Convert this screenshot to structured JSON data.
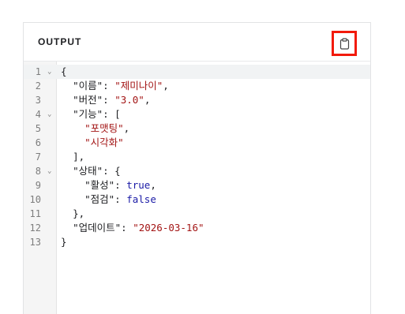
{
  "panel": {
    "title": "OUTPUT",
    "copy_icon": "clipboard-icon"
  },
  "editor": {
    "fold_glyph": "⌄",
    "lines": [
      {
        "n": "1",
        "fold": true,
        "active": true,
        "indent": "",
        "parts": [
          {
            "t": "{",
            "c": "punc"
          }
        ]
      },
      {
        "n": "2",
        "fold": false,
        "active": false,
        "indent": "  ",
        "parts": [
          {
            "t": "\"이름\"",
            "c": "key"
          },
          {
            "t": ": ",
            "c": "punc"
          },
          {
            "t": "\"제미나이\"",
            "c": "str"
          },
          {
            "t": ",",
            "c": "punc"
          }
        ]
      },
      {
        "n": "3",
        "fold": false,
        "active": false,
        "indent": "  ",
        "parts": [
          {
            "t": "\"버전\"",
            "c": "key"
          },
          {
            "t": ": ",
            "c": "punc"
          },
          {
            "t": "\"3.0\"",
            "c": "str"
          },
          {
            "t": ",",
            "c": "punc"
          }
        ]
      },
      {
        "n": "4",
        "fold": true,
        "active": false,
        "indent": "  ",
        "parts": [
          {
            "t": "\"기능\"",
            "c": "key"
          },
          {
            "t": ": [",
            "c": "punc"
          }
        ]
      },
      {
        "n": "5",
        "fold": false,
        "active": false,
        "indent": "    ",
        "parts": [
          {
            "t": "\"포맷팅\"",
            "c": "str"
          },
          {
            "t": ",",
            "c": "punc"
          }
        ]
      },
      {
        "n": "6",
        "fold": false,
        "active": false,
        "indent": "    ",
        "parts": [
          {
            "t": "\"시각화\"",
            "c": "str"
          }
        ]
      },
      {
        "n": "7",
        "fold": false,
        "active": false,
        "indent": "  ",
        "parts": [
          {
            "t": "],",
            "c": "punc"
          }
        ]
      },
      {
        "n": "8",
        "fold": true,
        "active": false,
        "indent": "  ",
        "parts": [
          {
            "t": "\"상태\"",
            "c": "key"
          },
          {
            "t": ": {",
            "c": "punc"
          }
        ]
      },
      {
        "n": "9",
        "fold": false,
        "active": false,
        "indent": "    ",
        "parts": [
          {
            "t": "\"활성\"",
            "c": "key"
          },
          {
            "t": ": ",
            "c": "punc"
          },
          {
            "t": "true",
            "c": "bool"
          },
          {
            "t": ",",
            "c": "punc"
          }
        ]
      },
      {
        "n": "10",
        "fold": false,
        "active": false,
        "indent": "    ",
        "parts": [
          {
            "t": "\"점검\"",
            "c": "key"
          },
          {
            "t": ": ",
            "c": "punc"
          },
          {
            "t": "false",
            "c": "bool"
          }
        ]
      },
      {
        "n": "11",
        "fold": false,
        "active": false,
        "indent": "  ",
        "parts": [
          {
            "t": "},",
            "c": "punc"
          }
        ]
      },
      {
        "n": "12",
        "fold": false,
        "active": false,
        "indent": "  ",
        "parts": [
          {
            "t": "\"업데이트\"",
            "c": "key"
          },
          {
            "t": ": ",
            "c": "punc"
          },
          {
            "t": "\"2026-03-16\"",
            "c": "str"
          }
        ]
      },
      {
        "n": "13",
        "fold": false,
        "active": false,
        "indent": "",
        "parts": [
          {
            "t": "}",
            "c": "punc"
          }
        ]
      }
    ]
  },
  "colors": {
    "string": "#a31515",
    "boolean": "#1a1aa6",
    "highlight_border": "#f21a0a"
  }
}
